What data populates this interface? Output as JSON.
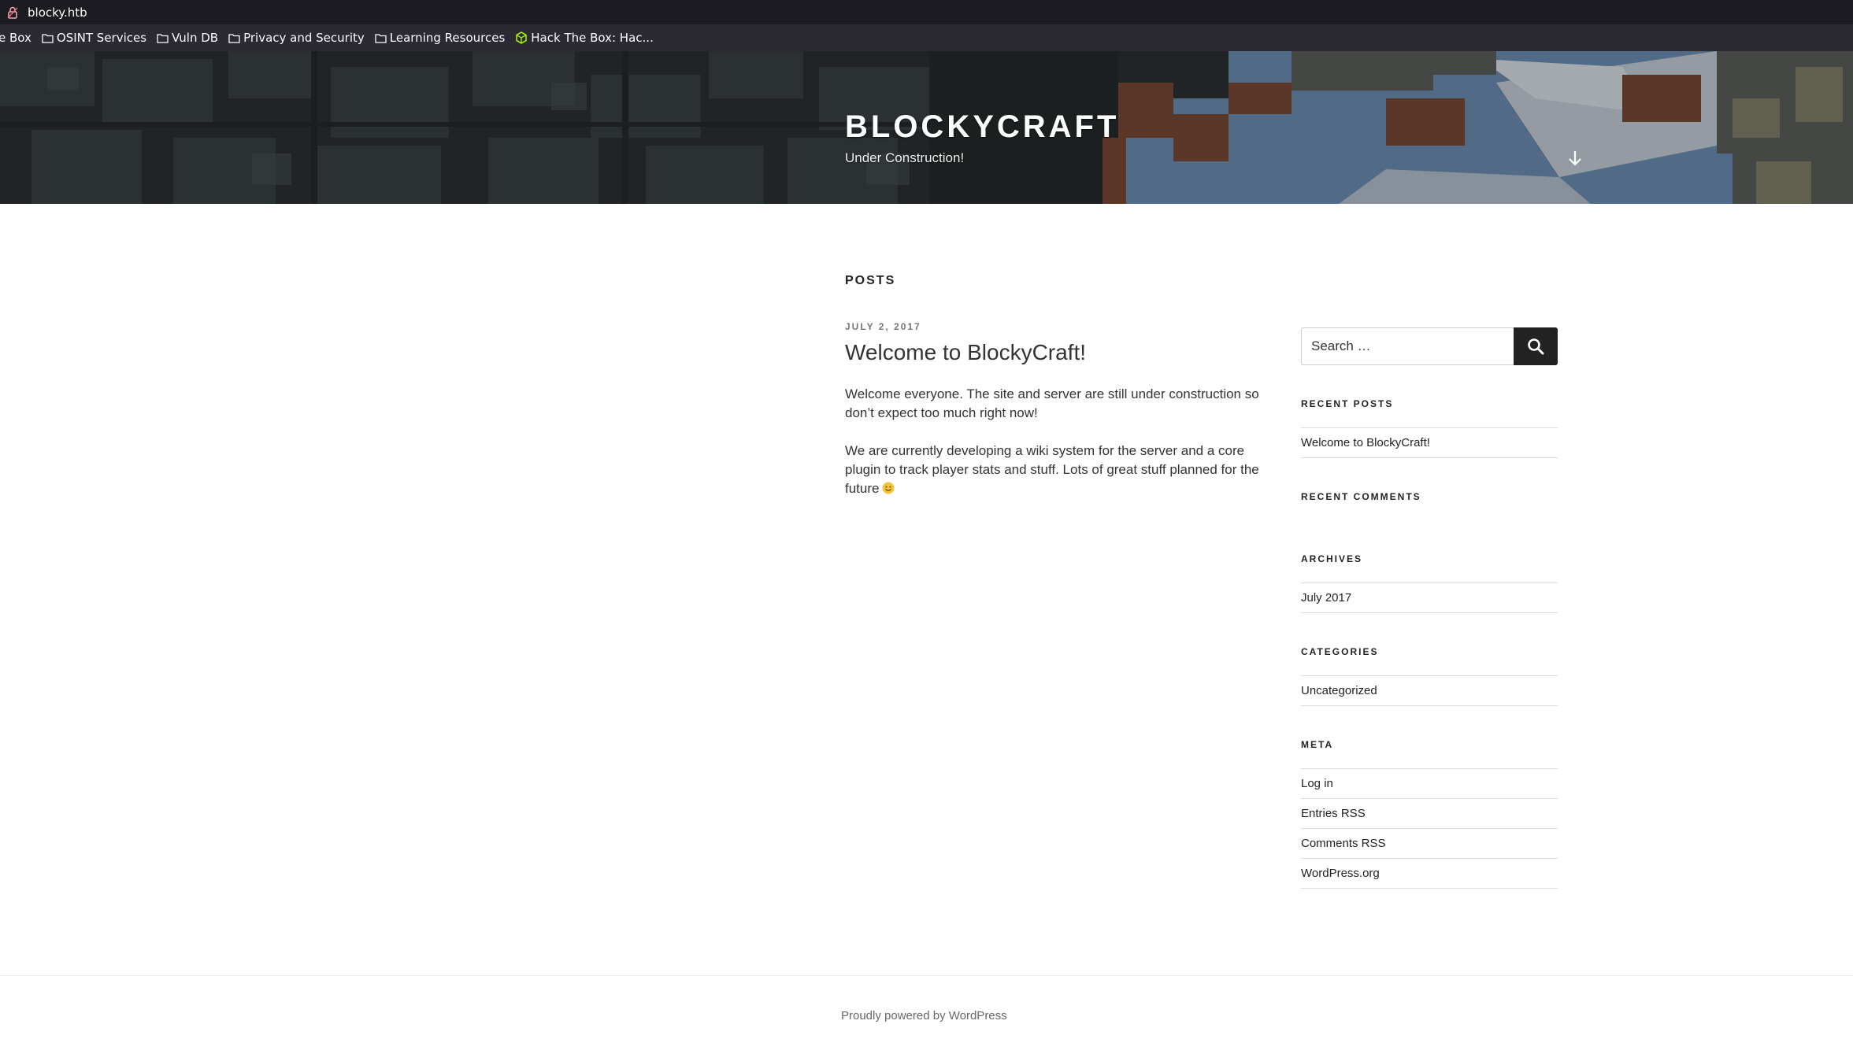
{
  "browser": {
    "url": "blocky.htb",
    "bookmarks": [
      {
        "label": "e Box",
        "icon": "none"
      },
      {
        "label": "OSINT Services",
        "icon": "folder-icon"
      },
      {
        "label": "Vuln DB",
        "icon": "folder-icon"
      },
      {
        "label": "Privacy and Security",
        "icon": "folder-icon"
      },
      {
        "label": "Learning Resources",
        "icon": "folder-icon"
      },
      {
        "label": "Hack The Box: Hac...",
        "icon": "hackthebox-icon"
      }
    ]
  },
  "header": {
    "title": "BLOCKYCRAFT",
    "description": "Under Construction!"
  },
  "main": {
    "page_header": "POSTS",
    "post": {
      "date": "JULY 2, 2017",
      "title": "Welcome to BlockyCraft!",
      "paragraph1": "Welcome everyone. The site and server are still under construction so don’t expect too much right now!",
      "paragraph2": "We are currently developing a wiki system for the server and a core plugin to track player stats and stuff. Lots of great stuff planned for the future"
    }
  },
  "sidebar": {
    "search_placeholder": "Search …",
    "recent_posts": {
      "title": "RECENT POSTS",
      "items": [
        "Welcome to BlockyCraft!"
      ]
    },
    "recent_comments": {
      "title": "RECENT COMMENTS"
    },
    "archives": {
      "title": "ARCHIVES",
      "items": [
        "July 2017"
      ]
    },
    "categories": {
      "title": "CATEGORIES",
      "items": [
        "Uncategorized"
      ]
    },
    "meta": {
      "title": "META",
      "items": [
        "Log in",
        "Entries RSS",
        "Comments RSS",
        "WordPress.org"
      ]
    }
  },
  "footer": {
    "text": "Proudly powered by WordPress"
  },
  "colors": {
    "header_text": "#ffffff",
    "body_text": "#333333",
    "search_button": "#222222"
  }
}
